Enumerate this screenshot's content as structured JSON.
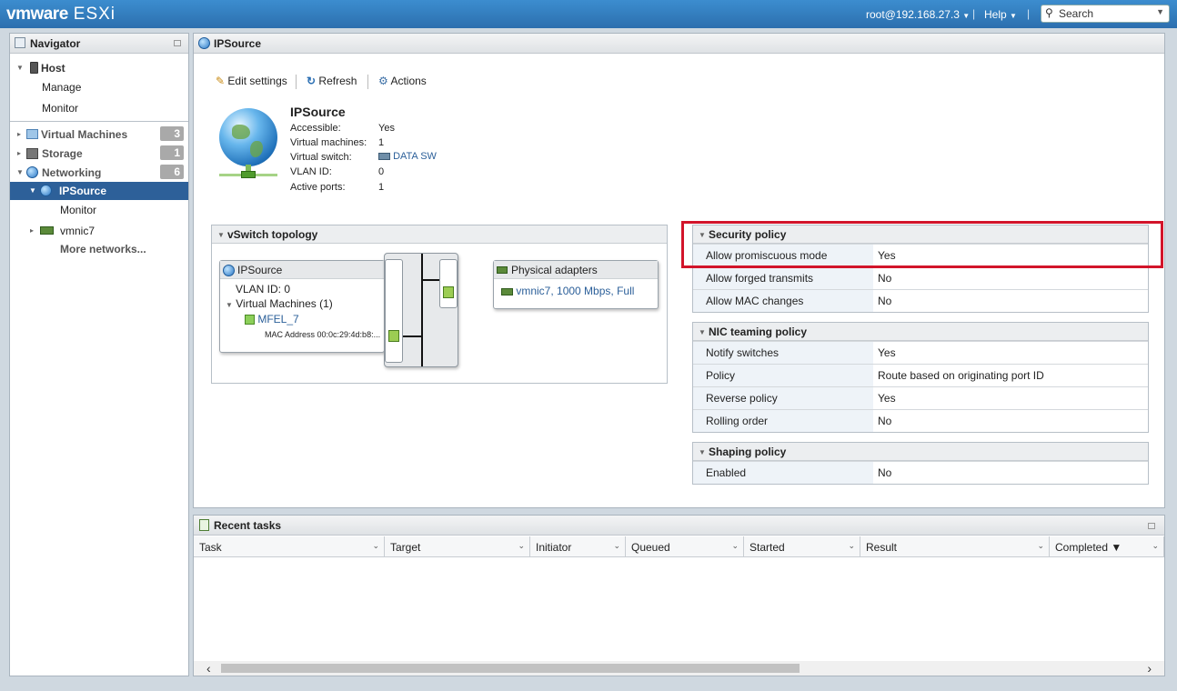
{
  "topbar": {
    "brand": "vmware",
    "product": "ESXi",
    "user": "root@192.168.27.3",
    "help": "Help",
    "search_placeholder": "Search"
  },
  "navigator": {
    "title": "Navigator",
    "host": "Host",
    "manage": "Manage",
    "monitor": "Monitor",
    "virtual_machines": "Virtual Machines",
    "vm_count": "3",
    "storage": "Storage",
    "storage_count": "1",
    "networking": "Networking",
    "networking_count": "6",
    "ipsource": "IPSource",
    "ipsource_monitor": "Monitor",
    "vmnic7": "vmnic7",
    "more_networks": "More networks..."
  },
  "main": {
    "title": "IPSource",
    "toolbar": {
      "edit": "Edit settings",
      "refresh": "Refresh",
      "actions": "Actions"
    },
    "summary": {
      "name": "IPSource",
      "fields": [
        {
          "k": "Accessible:",
          "v": "Yes"
        },
        {
          "k": "Virtual machines:",
          "v": "1"
        },
        {
          "k": "Virtual switch:",
          "v": "DATA SW"
        },
        {
          "k": "VLAN ID:",
          "v": "0"
        },
        {
          "k": "Active ports:",
          "v": "1"
        }
      ]
    },
    "topology": {
      "title": "vSwitch topology",
      "pg_title": "IPSource",
      "vlan": "VLAN ID: 0",
      "vms": "Virtual Machines (1)",
      "vm_name": "MFEL_7",
      "mac": "MAC Address 00:0c:29:4d:b8:...",
      "phys_title": "Physical adapters",
      "phys_nic": "vmnic7, 1000 Mbps, Full"
    },
    "security": {
      "title": "Security policy",
      "rows": [
        {
          "k": "Allow promiscuous mode",
          "v": "Yes"
        },
        {
          "k": "Allow forged transmits",
          "v": "No"
        },
        {
          "k": "Allow MAC changes",
          "v": "No"
        }
      ]
    },
    "teaming": {
      "title": "NIC teaming policy",
      "rows": [
        {
          "k": "Notify switches",
          "v": "Yes"
        },
        {
          "k": "Policy",
          "v": "Route based on originating port ID"
        },
        {
          "k": "Reverse policy",
          "v": "Yes"
        },
        {
          "k": "Rolling order",
          "v": "No"
        }
      ]
    },
    "shaping": {
      "title": "Shaping policy",
      "rows": [
        {
          "k": "Enabled",
          "v": "No"
        }
      ]
    }
  },
  "tasks": {
    "title": "Recent tasks",
    "columns": [
      "Task",
      "Target",
      "Initiator",
      "Queued",
      "Started",
      "Result",
      "Completed ▼"
    ]
  },
  "colors": {
    "topbar": "#2c6fae",
    "nav_selected": "#2d6099",
    "highlight": "#d2142a",
    "link": "#2b5f99"
  }
}
